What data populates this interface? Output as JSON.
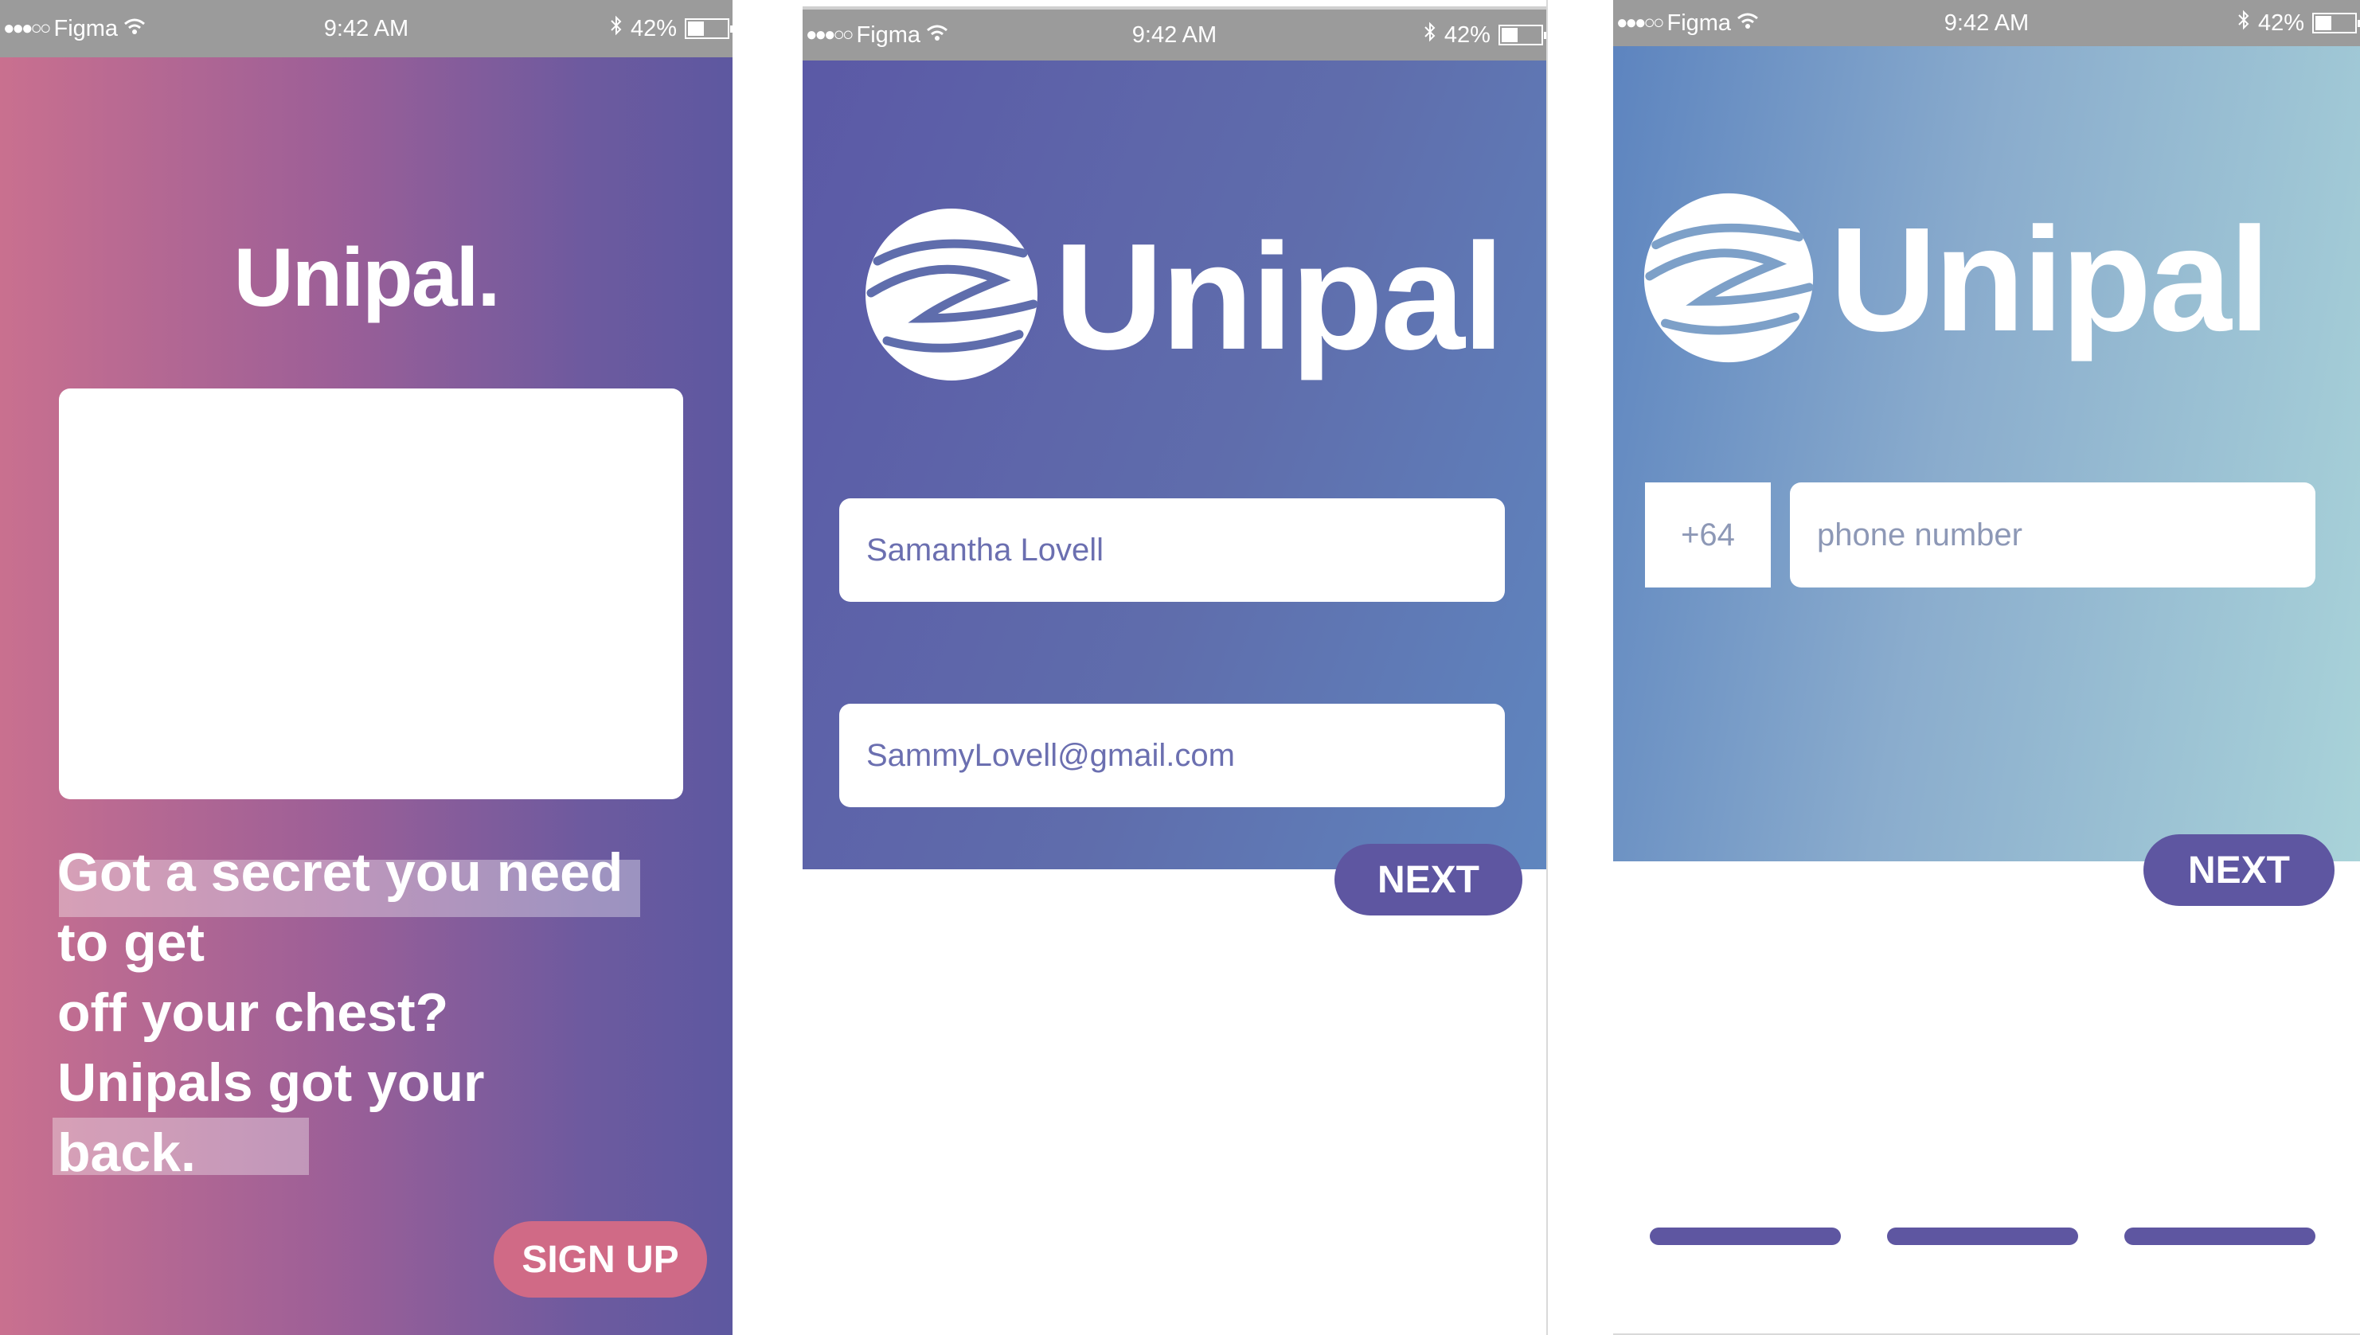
{
  "status_bar": {
    "carrier": "Figma",
    "signal_dots": "●●●○○",
    "time": "9:42 AM",
    "battery": "42%",
    "battery_level": 0.42
  },
  "screen_welcome": {
    "title": "Unipal.",
    "tagline_lines": [
      "Got a secret you need",
      "to get",
      "off your chest?",
      "Unipals got your",
      "back."
    ],
    "signup_label": "SIGN UP"
  },
  "screen_details": {
    "brand": "Unipal",
    "name_value": "Samantha Lovell",
    "email_value": "SammyLovell@gmail.com",
    "next_label": "NEXT"
  },
  "screen_phone": {
    "brand": "Unipal",
    "country_code": "+64",
    "phone_placeholder": "phone number",
    "next_label": "NEXT",
    "progress_steps": 3
  },
  "colors": {
    "accent": "#5e56a1",
    "signup": "#d06a86"
  },
  "icons": [
    "wifi-icon",
    "bluetooth-icon",
    "battery-icon",
    "unipal-logo-icon"
  ]
}
